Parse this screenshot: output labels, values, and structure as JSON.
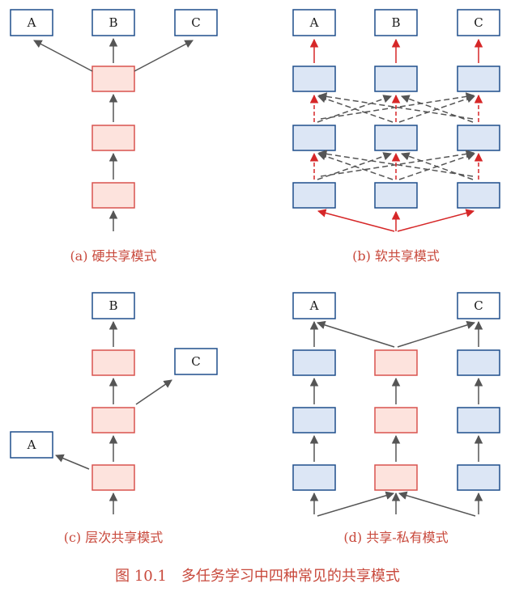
{
  "task_labels": {
    "a": "A",
    "b": "B",
    "c": "C"
  },
  "captions": {
    "a": "(a) 硬共享模式",
    "b": "(b) 软共享模式",
    "c": "(c) 层次共享模式",
    "d": "(d) 共享-私有模式"
  },
  "figure_caption": "图 10.1　多任务学习中四种常见的共享模式",
  "colors": {
    "shared_fill": "#fde3dd",
    "shared_stroke": "#d9534f",
    "private_fill": "#dce6f5",
    "private_stroke": "#1f4e8c",
    "output_stroke": "#1f4e8c",
    "arrow_gray": "#555555",
    "arrow_red": "#d62728",
    "caption": "#c8483b"
  }
}
